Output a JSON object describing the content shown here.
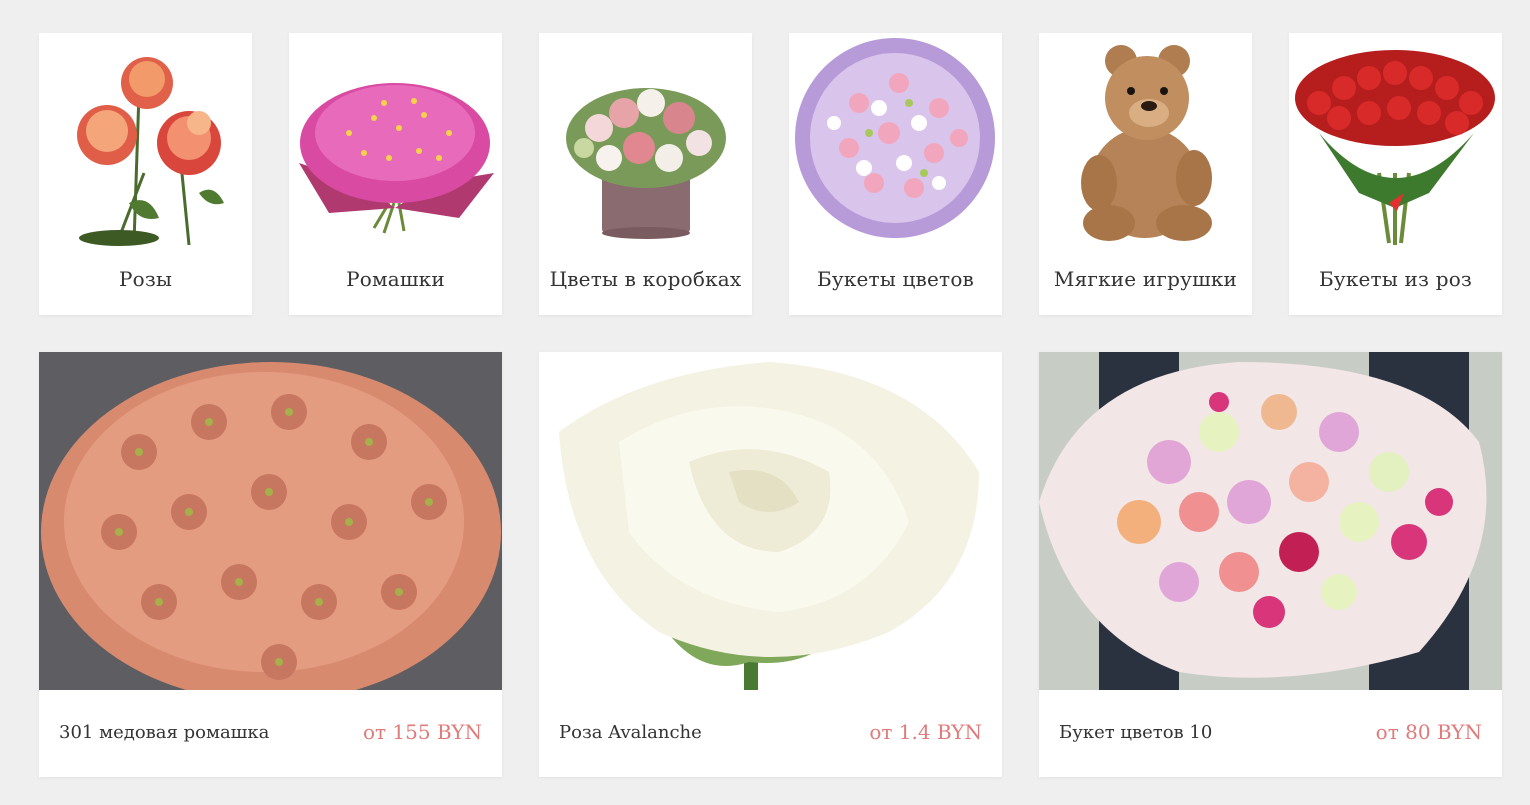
{
  "categories": [
    {
      "label": "Розы",
      "icon": "roses-image"
    },
    {
      "label": "Ромашки",
      "icon": "chamomile-image"
    },
    {
      "label": "Цветы в коробках",
      "icon": "flower-box-image"
    },
    {
      "label": "Букеты цветов",
      "icon": "bouquet-image"
    },
    {
      "label": "Мягкие игрушки",
      "icon": "teddy-bear-image"
    },
    {
      "label": "Букеты из роз",
      "icon": "red-roses-bouquet-image"
    }
  ],
  "products": [
    {
      "name": "301 медовая ромашка",
      "price": "от 155 BYN",
      "icon": "honey-chamomile-image"
    },
    {
      "name": "Роза Avalanche",
      "price": "от 1.4 BYN",
      "icon": "white-rose-image"
    },
    {
      "name": "Букет цветов 10",
      "price": "от 80 BYN",
      "icon": "mixed-bouquet-image"
    }
  ],
  "colors": {
    "background": "#efefef",
    "card": "#ffffff",
    "price": "#e07b7b",
    "text": "#333333"
  }
}
